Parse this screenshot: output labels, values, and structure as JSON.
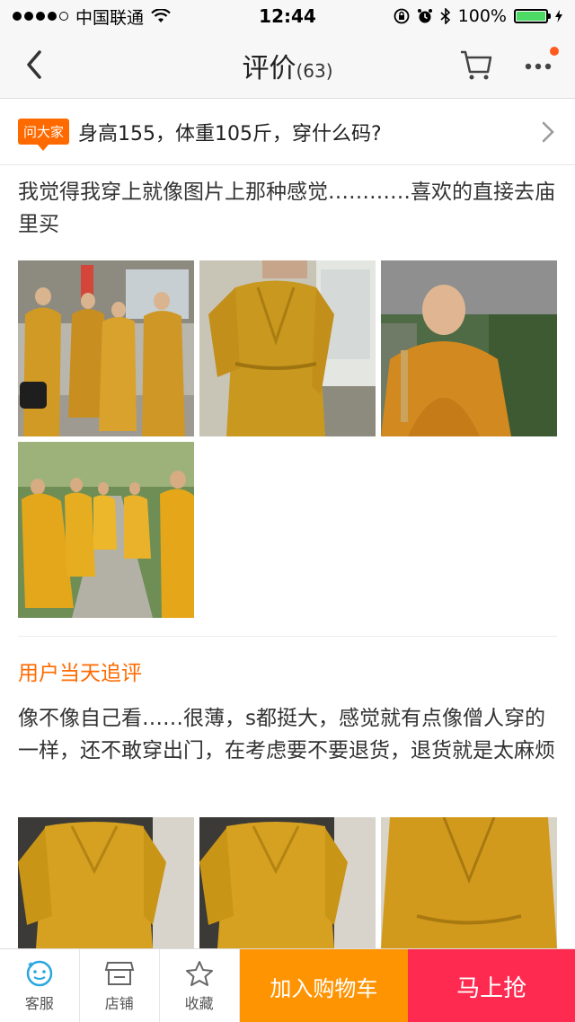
{
  "status_bar": {
    "carrier": "中国联通",
    "time": "12:44",
    "battery": "100%",
    "battery_level": 1.0
  },
  "nav": {
    "title": "评价",
    "count": "(63)"
  },
  "question": {
    "badge": "问大家",
    "text": "身高155，体重105斤，穿什么码?"
  },
  "review": {
    "text": "我觉得我穿上就像图片上那种感觉…………喜欢的直接去庙里买"
  },
  "followup": {
    "label": "用户当天追评",
    "text": "像不像自己看……很薄，s都挺大，感觉就有点像僧人穿的一样，还不敢穿出门，在考虑要不要退货，退货就是太麻烦"
  },
  "bottom_bar": {
    "service": "客服",
    "store": "店铺",
    "favorite": "收藏",
    "add_to_cart": "加入购物车",
    "buy_now": "马上抢"
  },
  "colors": {
    "accent": "#ff6a00",
    "cart_button": "#ff9402",
    "buy_button": "#ff2a4f",
    "robe": "#d6a021"
  }
}
